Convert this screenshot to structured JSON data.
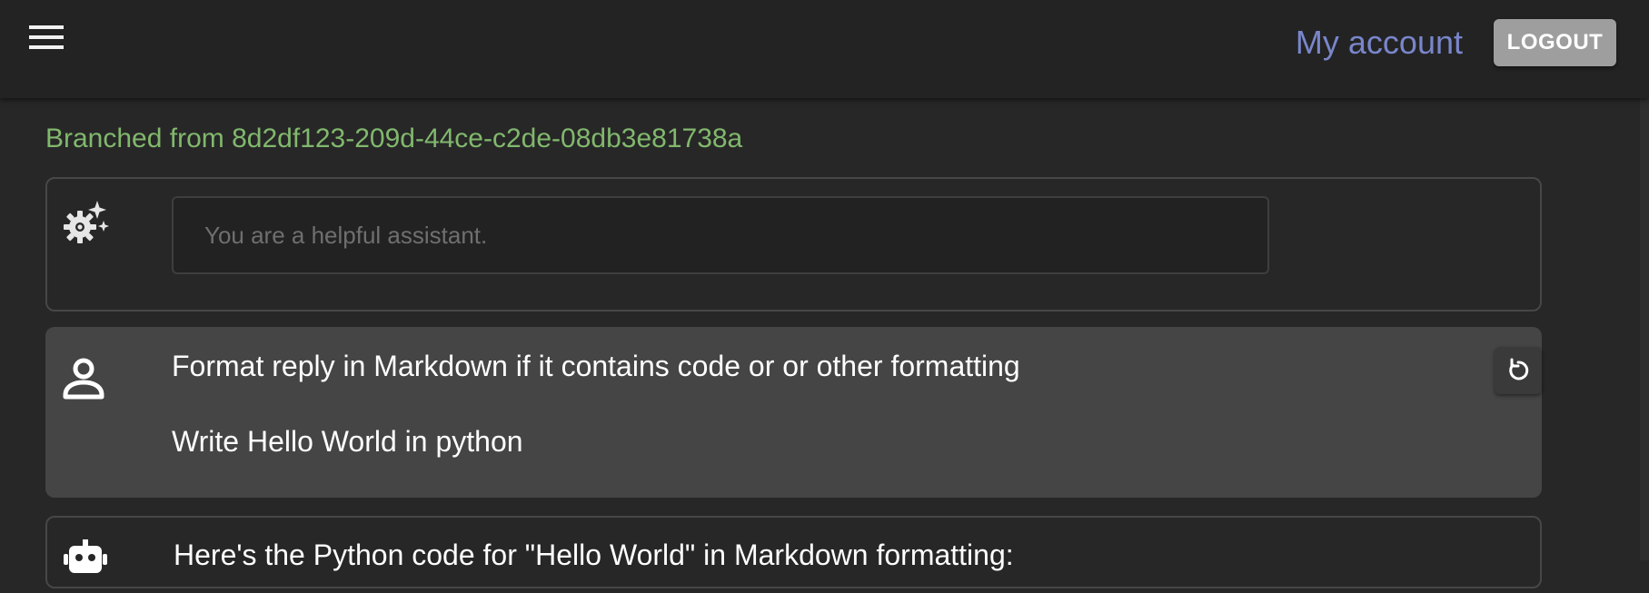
{
  "header": {
    "menu_icon": "hamburger-menu-icon",
    "account_label": "My account",
    "logout_label": "LOGOUT",
    "account_color": "#7986cb"
  },
  "conversation": {
    "branched_text": "Branched from 8d2df123-209d-44ce-c2de-08db3e81738a",
    "system": {
      "icon": "settings-sparkle-icon",
      "value": "",
      "placeholder": "You are a helpful assistant."
    },
    "user": {
      "icon": "person-icon",
      "line1": "Format reply in Markdown if it contains code or or other formatting",
      "line2": "Write Hello World in python",
      "action_icon": "refresh-icon"
    },
    "assistant": {
      "icon": "robot-icon",
      "text": "Here's the Python code for \"Hello World\" in Markdown formatting:"
    }
  }
}
